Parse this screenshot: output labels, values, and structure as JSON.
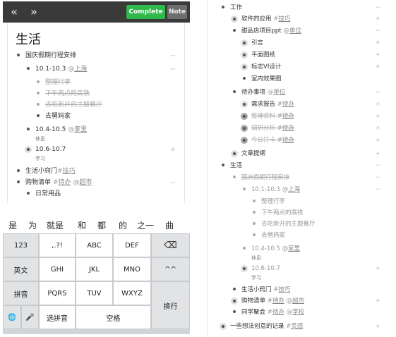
{
  "left": {
    "nav": {
      "back": "«",
      "forward": "»"
    },
    "buttons": {
      "complete": "Complete",
      "note": "Note"
    },
    "title": "生活",
    "items": {
      "holiday": "国庆假期行程安排",
      "trip1": "10.1-10.3",
      "trip1_at": "@",
      "trip1_loc": "上海",
      "pack": "整理行李",
      "bridge": "下午两点的高铁",
      "restaurant": "去吃新开的主题餐厅",
      "grandma": "去舅妈家",
      "trip2": "10.4-10.5",
      "trip2_at": "@",
      "trip2_loc": "家里",
      "trip2_note": "休息",
      "trip3": "10.6-10.7",
      "trip3_note": "学习",
      "tips": "生活小窍门",
      "tips_tag_hash": "#",
      "tips_tag": "技巧",
      "shopping": "购物清单",
      "shopping_tag_hash": "#",
      "shopping_tag": "待办",
      "shopping_at": "@",
      "shopping_loc": "超市",
      "daily": "日常用品"
    },
    "suggestions": [
      "是",
      "为",
      "就是",
      "和",
      "都",
      "的",
      "之一",
      "曲"
    ],
    "keyboard": {
      "row1": [
        "123",
        ",.?!",
        "ABC",
        "DEF",
        "⌫"
      ],
      "row2": [
        "英文",
        "GHI",
        "JKL",
        "MNO",
        "^^"
      ],
      "row3": [
        "拼音",
        "PQRS",
        "TUV",
        "WXYZ"
      ],
      "return": "换行",
      "globe": "🌐",
      "mic": "🎤",
      "select": "选拼音",
      "space": "空格"
    }
  },
  "right": {
    "work": "工作",
    "software": "软件的应用",
    "software_hash": "#",
    "software_tag": "技巧",
    "dessert_ppt": "甜品店项目ppt",
    "dessert_at": "@",
    "dessert_loc": "单位",
    "intro": "引言",
    "plan": "平面图纸",
    "vi": "标志VI设计",
    "render": "室内效果图",
    "todo": "待办事项",
    "todo_at": "@",
    "todo_loc": "单位",
    "report": "需求报告",
    "report_hash": "#",
    "report_tag": "待办",
    "material": "整理资料",
    "material_hash": "#",
    "material_tag": "待办",
    "analysis": "调研分析",
    "analysis_hash": "#",
    "analysis_tag": "待办",
    "checkin": "今日打卡",
    "checkin_hash": "#",
    "checkin_tag": "待办",
    "outline": "文章提纲",
    "life": "生活",
    "holiday": "国庆假期行程安排",
    "trip1": "10.1-10.3",
    "trip1_at": "@",
    "trip1_loc": "上海",
    "pack": "整理行李",
    "bridge": "下午两点的高铁",
    "restaurant": "去吃新开的主题餐厅",
    "grandma": "去舅妈家",
    "trip2": "10.4-10.5",
    "trip2_at": "@",
    "trip2_loc": "家里",
    "trip2_note": "休息",
    "trip3": "10.6-10.7",
    "trip3_note": "学习",
    "tips": "生活小窍门",
    "tips_hash": "#",
    "tips_tag": "技巧",
    "shopping": "购物清单",
    "shopping_hash": "#",
    "shopping_tag": "待办",
    "shopping_at": "@",
    "shopping_loc": "超市",
    "party": "同学聚会",
    "party_hash": "#",
    "party_tag": "待办",
    "party_at": "@",
    "party_loc": "学校",
    "ideas": "一些想法创意的记录",
    "ideas_hash": "#",
    "ideas_tag": "灵感"
  },
  "controls": {
    "minus": "−",
    "plus": "+"
  }
}
